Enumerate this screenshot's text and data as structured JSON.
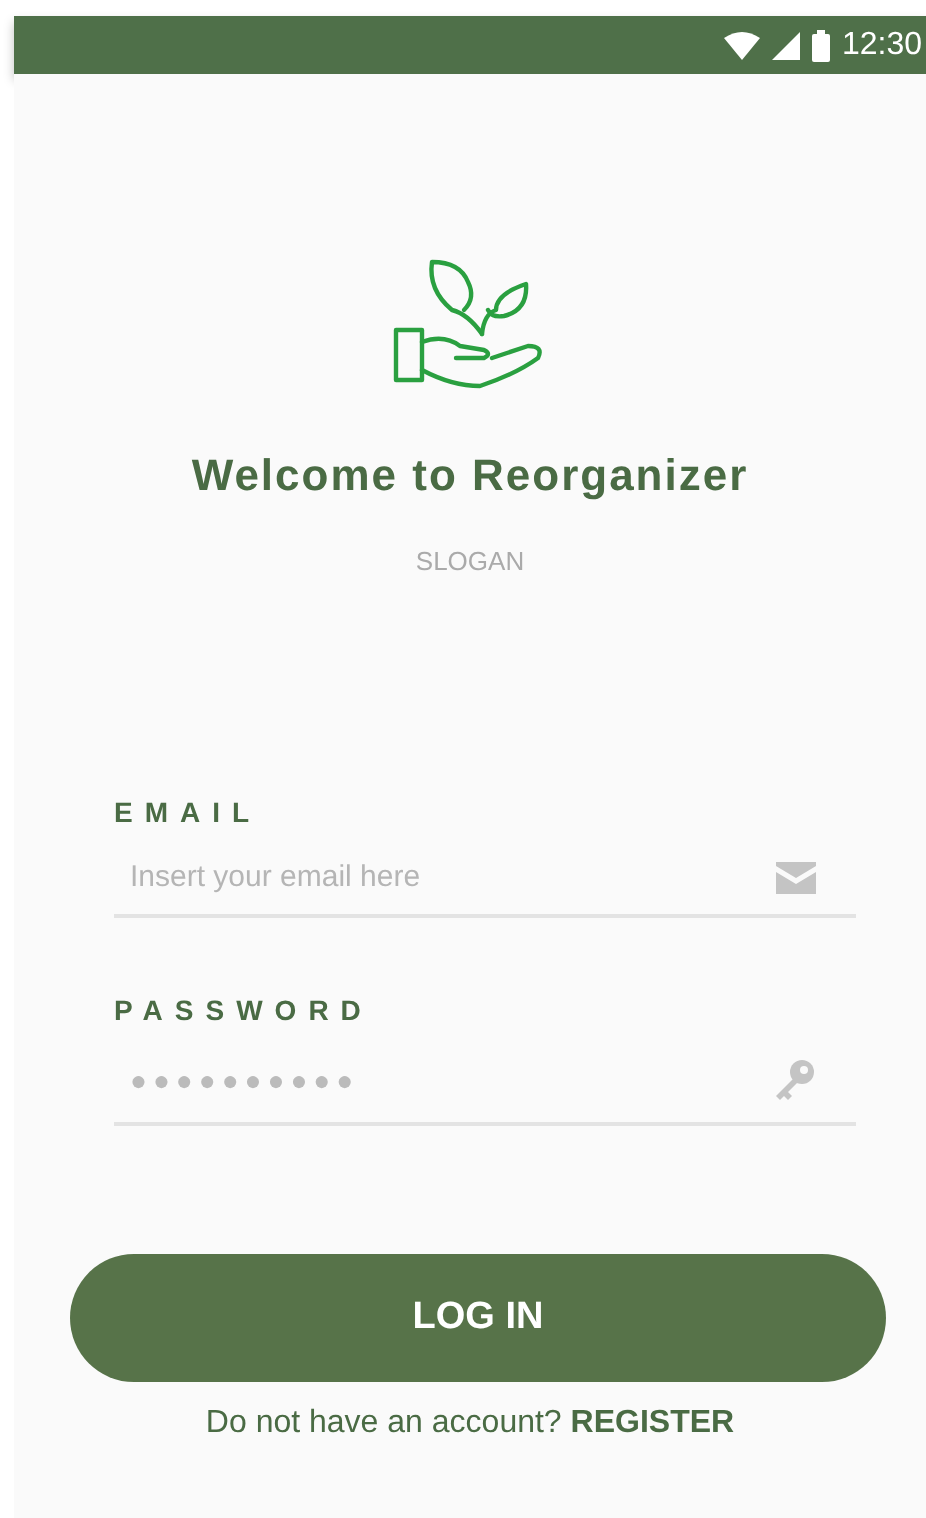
{
  "status_bar": {
    "time": "12:30"
  },
  "header": {
    "title": "Welcome to Reorganizer",
    "slogan": "SLOGAN"
  },
  "fields": [
    {
      "kind": "email",
      "label": "EMAIL",
      "placeholder": "Insert your email here"
    },
    {
      "kind": "password",
      "label": "PASSWORD",
      "value": "●●●●●●●●●●"
    }
  ],
  "login_button": "LOG IN",
  "footer": {
    "prompt": "Do not have an account?",
    "link": "REGISTER"
  }
}
